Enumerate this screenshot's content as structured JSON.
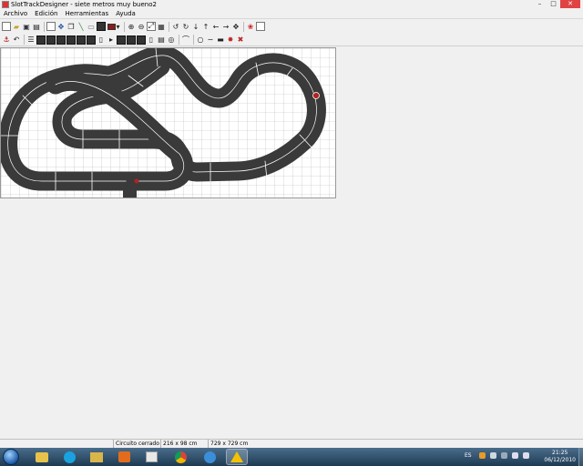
{
  "window": {
    "title": "SlotTrackDesigner - siete metros muy bueno2",
    "minimize": "–",
    "maximize": "□",
    "close": "✕"
  },
  "menu": {
    "items": [
      "Archivo",
      "Edición",
      "Herramientas",
      "Ayuda"
    ]
  },
  "toolbar1": {
    "icons": [
      "new-icon",
      "open-icon",
      "save-icon",
      "print-icon",
      "print-preview-icon",
      "page-icon",
      "move-icon",
      "copy-icon",
      "paint-icon",
      "eraser-icon",
      "box-icon",
      "color-picker-icon",
      "zoom-in-icon",
      "zoom-out-icon",
      "zoom-fit-icon",
      "grid-icon",
      "rotate-left-icon",
      "rotate-right-icon",
      "arrow-down-icon",
      "arrow-up-icon",
      "arrow-left-icon",
      "arrow-right-icon",
      "move-all-icon",
      "decorate-icon",
      "blank-icon"
    ],
    "color_swatch": "#8b1a1a"
  },
  "toolbar2": {
    "icons": [
      "anchor-icon",
      "undo-icon",
      "lane-change-icon",
      "straight-1-icon",
      "straight-2-icon",
      "straight-3-icon",
      "crossover-icon",
      "curve-icon",
      "piece-a-icon",
      "piece-b-icon",
      "piece-c-icon",
      "play-icon",
      "piece-d-icon",
      "piece-e-icon",
      "piece-f-icon",
      "piece-g-icon",
      "piece-h-icon",
      "bridge-icon",
      "hairpin-icon",
      "chicane-icon",
      "dash-icon",
      "stop-icon",
      "cross-icon"
    ]
  },
  "status": {
    "circuit": "Circuito cerrado",
    "size": "216 x 98 cm",
    "area": "729 x 729 cm"
  },
  "taskbar": {
    "lang": "ES",
    "time": "21:25",
    "date": "06/12/2010"
  },
  "colors": {
    "track": "#3a3a3a",
    "grid": "#b8b8b8",
    "canvas": "#ffffff",
    "marker": "#b22222"
  }
}
